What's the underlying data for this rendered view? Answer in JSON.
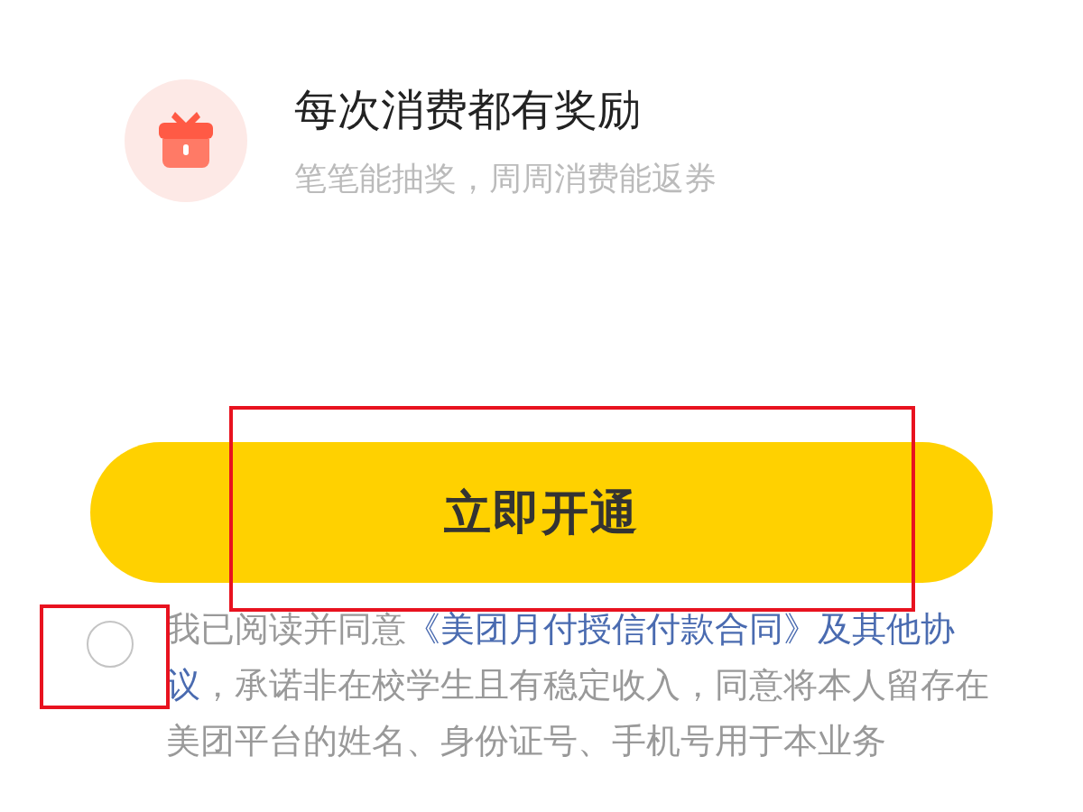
{
  "benefit": {
    "title": "每次消费都有奖励",
    "subtitle": "笔笔能抽奖，周周消费能返券"
  },
  "open_button": {
    "label": "立即开通"
  },
  "agreement": {
    "checked": false,
    "prefix": "我已阅读并同意",
    "link_lines": [
      "《美团月付授信付款合同》及其他协",
      "议"
    ],
    "suffix": "，承诺非在校学生且有稳定收入，同意将本人留存在美团平台的姓名、身份证号、手机号用于本业务"
  }
}
